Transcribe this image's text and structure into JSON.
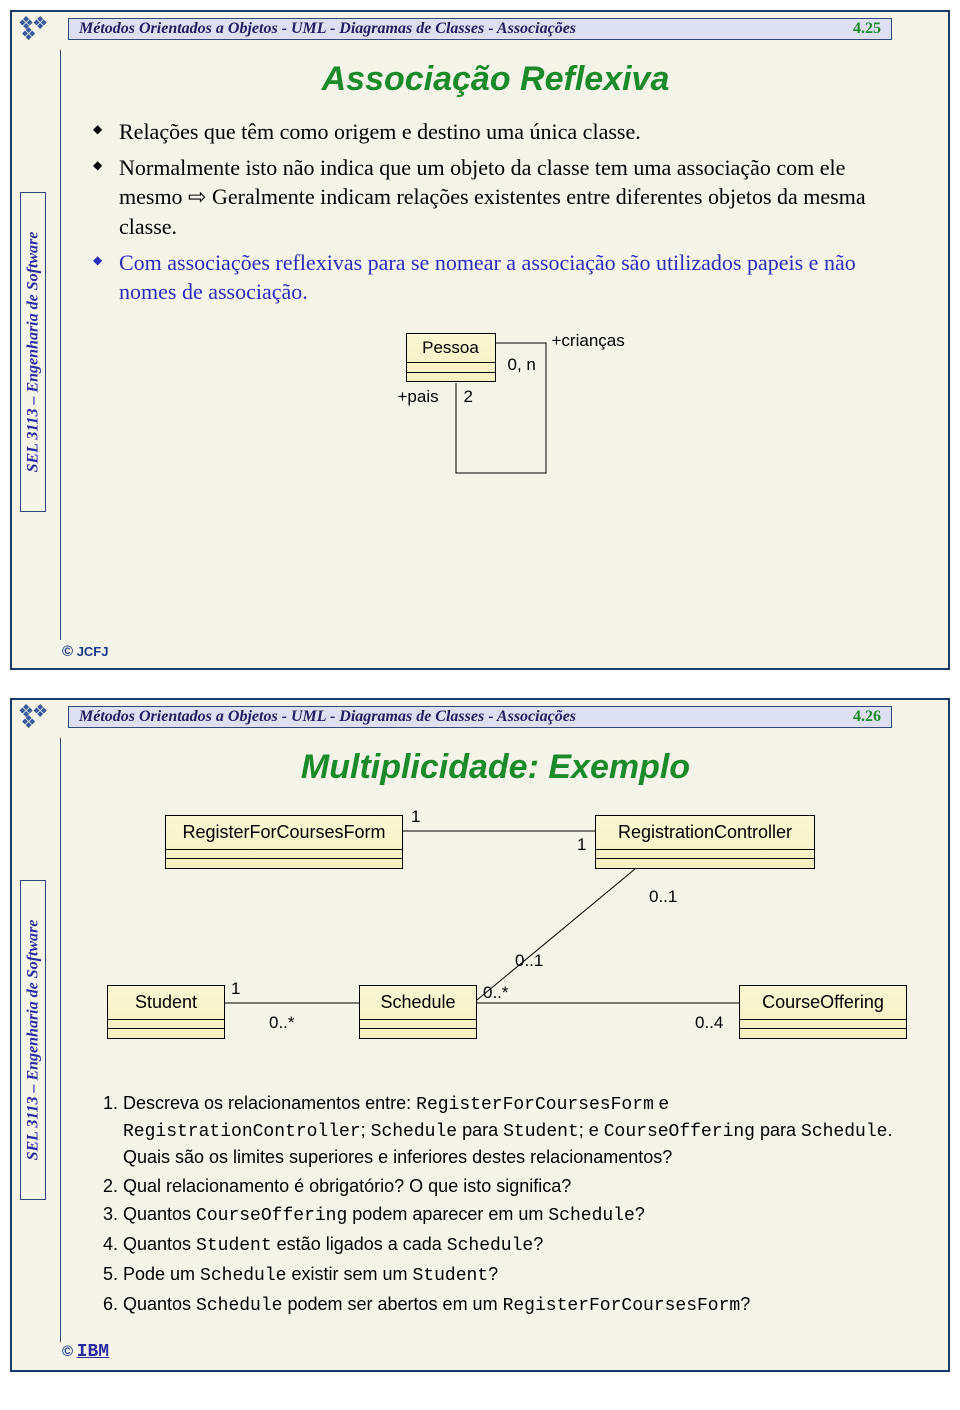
{
  "course_side_label": "SEL 3113 – Engenharia de Software",
  "header_text": "Métodos Orientados a Objetos - UML - Diagramas de Classes - Associações",
  "slide1": {
    "page": "4.25",
    "title": "Associação Reflexiva",
    "bullets": [
      "Relações que têm como origem e destino uma única classe.",
      "Normalmente isto não indica que um objeto da classe tem uma associação com ele mesmo ⇨ Geralmente indicam relações existentes entre diferentes objetos da mesma  classe.",
      "Com associações reflexivas para se nomear a associação são utilizados papeis e não nomes de associação."
    ],
    "uml": {
      "class_name": "Pessoa",
      "role_children": "+crianças",
      "mult_children": "0, n",
      "role_parents": "+pais",
      "mult_parents": "2"
    },
    "footer": "JCFJ"
  },
  "slide2": {
    "page": "4.26",
    "title": "Multiplicidade: Exemplo",
    "classes": {
      "rfcf": "RegisterForCoursesForm",
      "rc": "RegistrationController",
      "student": "Student",
      "schedule": "Schedule",
      "co": "CourseOffering"
    },
    "mult": {
      "rfcf_rc_left": "1",
      "rfcf_rc_right": "1",
      "rc_sched_top": "0..1",
      "rc_sched_bottom": "0..1",
      "stu_sched_left": "1",
      "stu_sched_right": "0..*",
      "sched_co_left": "0..*",
      "sched_co_right": "0..4"
    },
    "q_intro_a": "Descreva os relacionamentos entre: ",
    "q_intro_b": " e ",
    "q_intro_c": "; ",
    "q_intro_d": " para ",
    "q_intro_e": "; e ",
    "q_intro_f": " para ",
    "q_intro_g": ". Quais são os limites superiores e inferiores destes relacionamentos?",
    "q2": "Qual relacionamento é obrigatório? O que isto significa?",
    "q3a": "Quantos ",
    "q3b": " podem aparecer em um ",
    "q3c": "?",
    "q4a": "Quantos ",
    "q4b": " estão ligados a cada ",
    "q4c": "?",
    "q5a": "Pode um ",
    "q5b": " existir sem um ",
    "q5c": "?",
    "q6a": "Quantos ",
    "q6b": " podem ser abertos em um ",
    "q6c": "?",
    "footer_logo": "IBM"
  },
  "copyright": "©"
}
